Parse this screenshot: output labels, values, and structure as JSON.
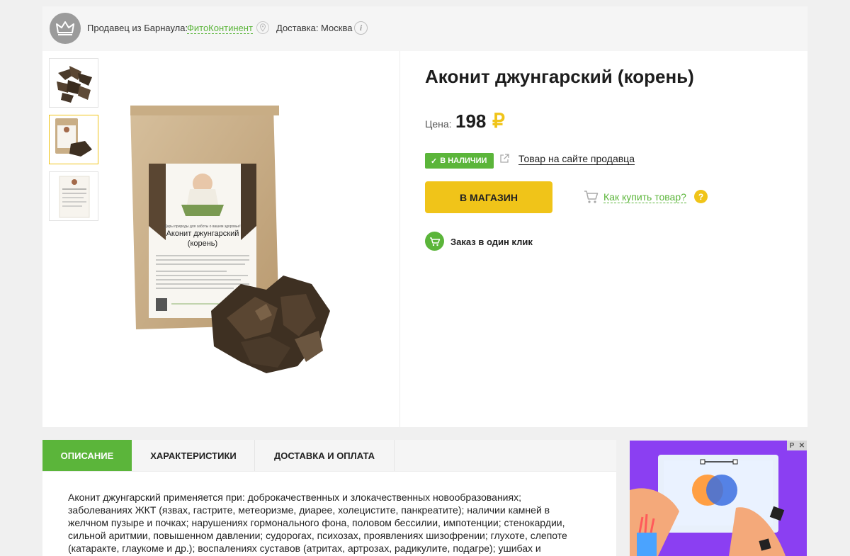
{
  "seller_bar": {
    "seller_prefix": "Продавец из Барнаула:",
    "seller_name": "ФитоКонтинент",
    "delivery": "Доставка: Москва",
    "info_mark": "i"
  },
  "product": {
    "title": "Аконит джунгарский (корень)",
    "price_label": "Цена:",
    "price": "198",
    "currency": "₽",
    "stock": "В НАЛИЧИИ",
    "seller_site_link": "Товар на сайте продавца",
    "shop_button": "В МАГАЗИН",
    "how_to_buy": "Как купить товар?",
    "help_mark": "?",
    "one_click": "Заказ в один клик"
  },
  "package": {
    "tagline": "Дары природы для заботы о вашем здоровье!",
    "name_line1": "Аконит джунгарский",
    "name_line2": "(корень)"
  },
  "tabs": [
    {
      "label": "Описание"
    },
    {
      "label": "Характеристики"
    },
    {
      "label": "Доставка и оплата"
    }
  ],
  "description": "Аконит джунгарский применяется при: доброкачественных и злокачественных новообразованиях; заболеваниях ЖКТ (язвах, гастрите, метеоризме, диарее, холецистите, панкреатите); наличии камней в желчном пузыре и почках; нарушениях гормонального фона, половом бессилии, импотенции; стенокардии, сильной аритмии, повышенном давлении; судорогах, психозах, проявлениях шизофрении; глухоте, слепоте (катаракте, глаукоме и др.); воспалениях суставов (атритах, артрозах, радикулите, подагре); ушибах и",
  "ad": {
    "badge_p": "P",
    "badge_x": "✕"
  },
  "colors": {
    "accent_green": "#5bb53a",
    "accent_yellow": "#f0c419",
    "ad_purple": "#8b3ff2"
  }
}
